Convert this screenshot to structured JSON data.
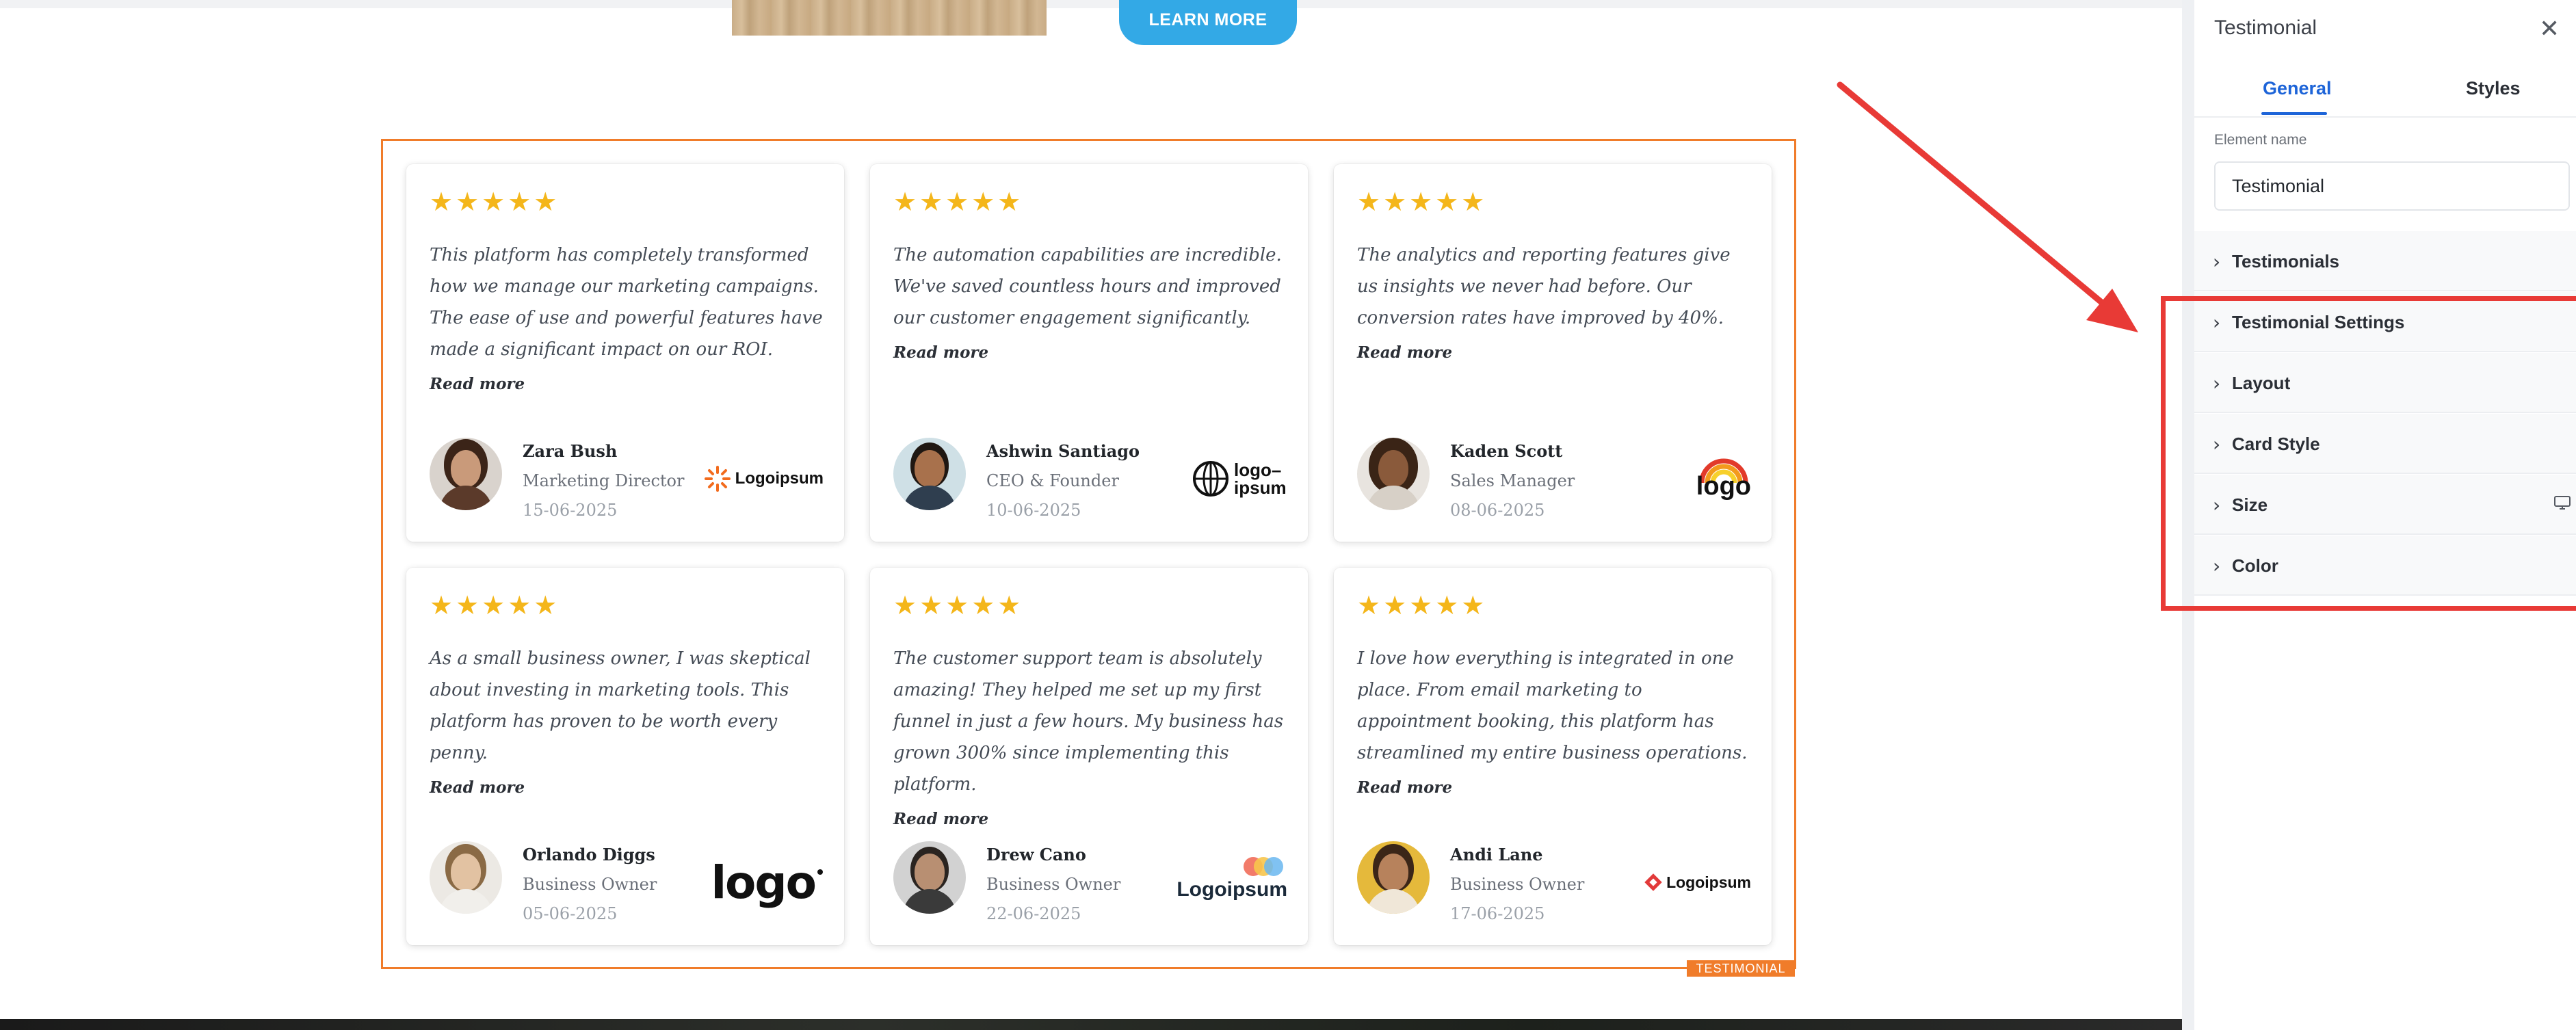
{
  "canvas": {
    "learn_more_label": "LEARN MORE",
    "section_tag": "TESTIMONIAL",
    "star_color": "#f4b61a",
    "accent_color": "#f07c2a"
  },
  "testimonials": [
    {
      "rating": 5,
      "stars": "★★★★★",
      "quote": "This platform has completely transformed how we manage our marketing campaigns. The ease of use and powerful features have made a significant impact on our ROI.",
      "read_more": "Read more",
      "name": "Zara Bush",
      "role": "Marketing Director",
      "date": "15-06-2025",
      "logo_text": "Logoipsum"
    },
    {
      "rating": 5,
      "stars": "★★★★★",
      "quote": "The automation capabilities are incredible. We've saved countless hours and improved our customer engagement significantly.",
      "read_more": "Read more",
      "name": "Ashwin Santiago",
      "role": "CEO & Founder",
      "date": "10-06-2025",
      "logo_text": "logo–ipsum"
    },
    {
      "rating": 5,
      "stars": "★★★★★",
      "quote": "The analytics and reporting features give us insights we never had before. Our conversion rates have improved by 40%.",
      "read_more": "Read more",
      "name": "Kaden Scott",
      "role": "Sales Manager",
      "date": "08-06-2025",
      "logo_text": "logo"
    },
    {
      "rating": 5,
      "stars": "★★★★★",
      "quote": "As a small business owner, I was skeptical about investing in marketing tools. This platform has proven to be worth every penny.",
      "read_more": "Read more",
      "name": "Orlando Diggs",
      "role": "Business Owner",
      "date": "05-06-2025",
      "logo_text": "logo"
    },
    {
      "rating": 5,
      "stars": "★★★★★",
      "quote": "The customer support team is absolutely amazing! They helped me set up my first funnel in just a few hours. My business has grown 300% since implementing this platform.",
      "read_more": "Read more",
      "name": "Drew Cano",
      "role": "Business Owner",
      "date": "22-06-2025",
      "logo_text": "Logoipsum"
    },
    {
      "rating": 5,
      "stars": "★★★★★",
      "quote": "I love how everything is integrated in one place. From email marketing to appointment booking, this platform has streamlined my entire business operations.",
      "read_more": "Read more",
      "name": "Andi Lane",
      "role": "Business Owner",
      "date": "17-06-2025",
      "logo_text": "Logoipsum"
    }
  ],
  "panel": {
    "title": "Testimonial",
    "close_icon": "close-icon",
    "tabs": [
      {
        "label": "General",
        "active": true
      },
      {
        "label": "Styles",
        "active": false
      }
    ],
    "element_name_label": "Element name",
    "element_name_value": "Testimonial",
    "sections": [
      {
        "label": "Testimonials"
      },
      {
        "label": "Testimonial Settings"
      },
      {
        "label": "Layout"
      },
      {
        "label": "Card Style"
      },
      {
        "label": "Size",
        "icon": "desktop-icon"
      },
      {
        "label": "Color"
      }
    ],
    "active_tab_color": "#1d64d8"
  },
  "annotation": {
    "color": "#e83a36"
  }
}
